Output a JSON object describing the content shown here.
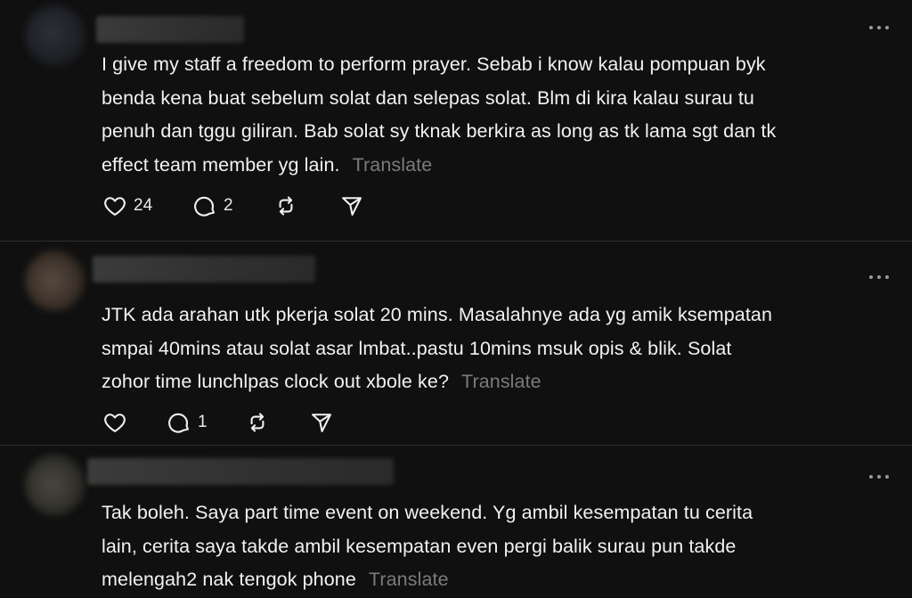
{
  "posts": [
    {
      "lines": [
        "I give my staff a freedom to perform prayer. Sebab i know kalau pompuan byk",
        "benda kena buat sebelum solat dan selepas solat. Blm di kira kalau surau tu",
        "penuh dan tggu giliran. Bab solat sy tknak berkira as long as tk lama sgt dan tk",
        "effect team member yg lain."
      ],
      "translate_label": "Translate",
      "likes": "24",
      "replies": "2"
    },
    {
      "lines": [
        "JTK ada arahan utk pkerja solat 20 mins. Masalahnye ada yg amik ksempatan",
        "smpai 40mins atau solat asar lmbat..pastu 10mins msuk opis & blik. Solat",
        "zohor time lunchlpas clock out xbole ke?"
      ],
      "translate_label": "Translate",
      "likes": "",
      "replies": "1"
    },
    {
      "lines": [
        "Tak boleh. Saya part time event on weekend. Yg ambil kesempatan tu cerita",
        "lain, cerita saya takde ambil kesempatan even pergi balik surau pun takde",
        "melengah2 nak tengok phone"
      ],
      "translate_label": "Translate"
    }
  ],
  "icons": {
    "like": "heart-icon",
    "reply": "comment-icon",
    "repost": "repost-icon",
    "share": "send-icon",
    "more": "more-horizontal-icon"
  },
  "colors": {
    "background": "#101010",
    "text": "#f2f2f2",
    "translate": "#7b7b7b",
    "divider": "#2e2e2e"
  }
}
